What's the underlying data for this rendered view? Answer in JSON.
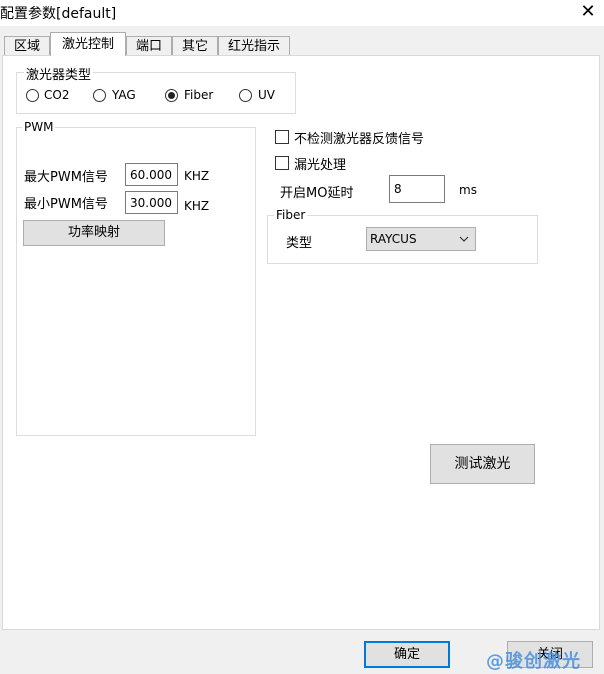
{
  "window": {
    "title": "配置参数[default]",
    "close_glyph": "✕"
  },
  "tabs": [
    {
      "label": "区域",
      "active": false
    },
    {
      "label": "激光控制",
      "active": true
    },
    {
      "label": "端口",
      "active": false
    },
    {
      "label": "其它",
      "active": false
    },
    {
      "label": "红光指示",
      "active": false
    }
  ],
  "laser_type": {
    "label": "激光器类型",
    "options": [
      "CO2",
      "YAG",
      "Fiber",
      "UV"
    ],
    "selected": "Fiber"
  },
  "pwm": {
    "label": "PWM",
    "max_label": "最大PWM信号",
    "max_value": "60.000",
    "max_unit": "KHZ",
    "min_label": "最小PWM信号",
    "min_value": "30.000",
    "min_unit": "KHZ",
    "power_map_button": "功率映射"
  },
  "options": {
    "no_feedback_label": "不检测激光器反馈信号",
    "no_feedback_checked": false,
    "leak_label": "漏光处理",
    "leak_checked": false,
    "mo_delay_label": "开启MO延时",
    "mo_delay_value": "8",
    "mo_delay_unit": "ms"
  },
  "fiber": {
    "label": "Fiber",
    "type_label": "类型",
    "type_value": "RAYCUS"
  },
  "test_laser_button": "测试激光",
  "footer": {
    "ok_button": "确定",
    "close_button": "关闭",
    "watermark": "@骏创激光"
  }
}
